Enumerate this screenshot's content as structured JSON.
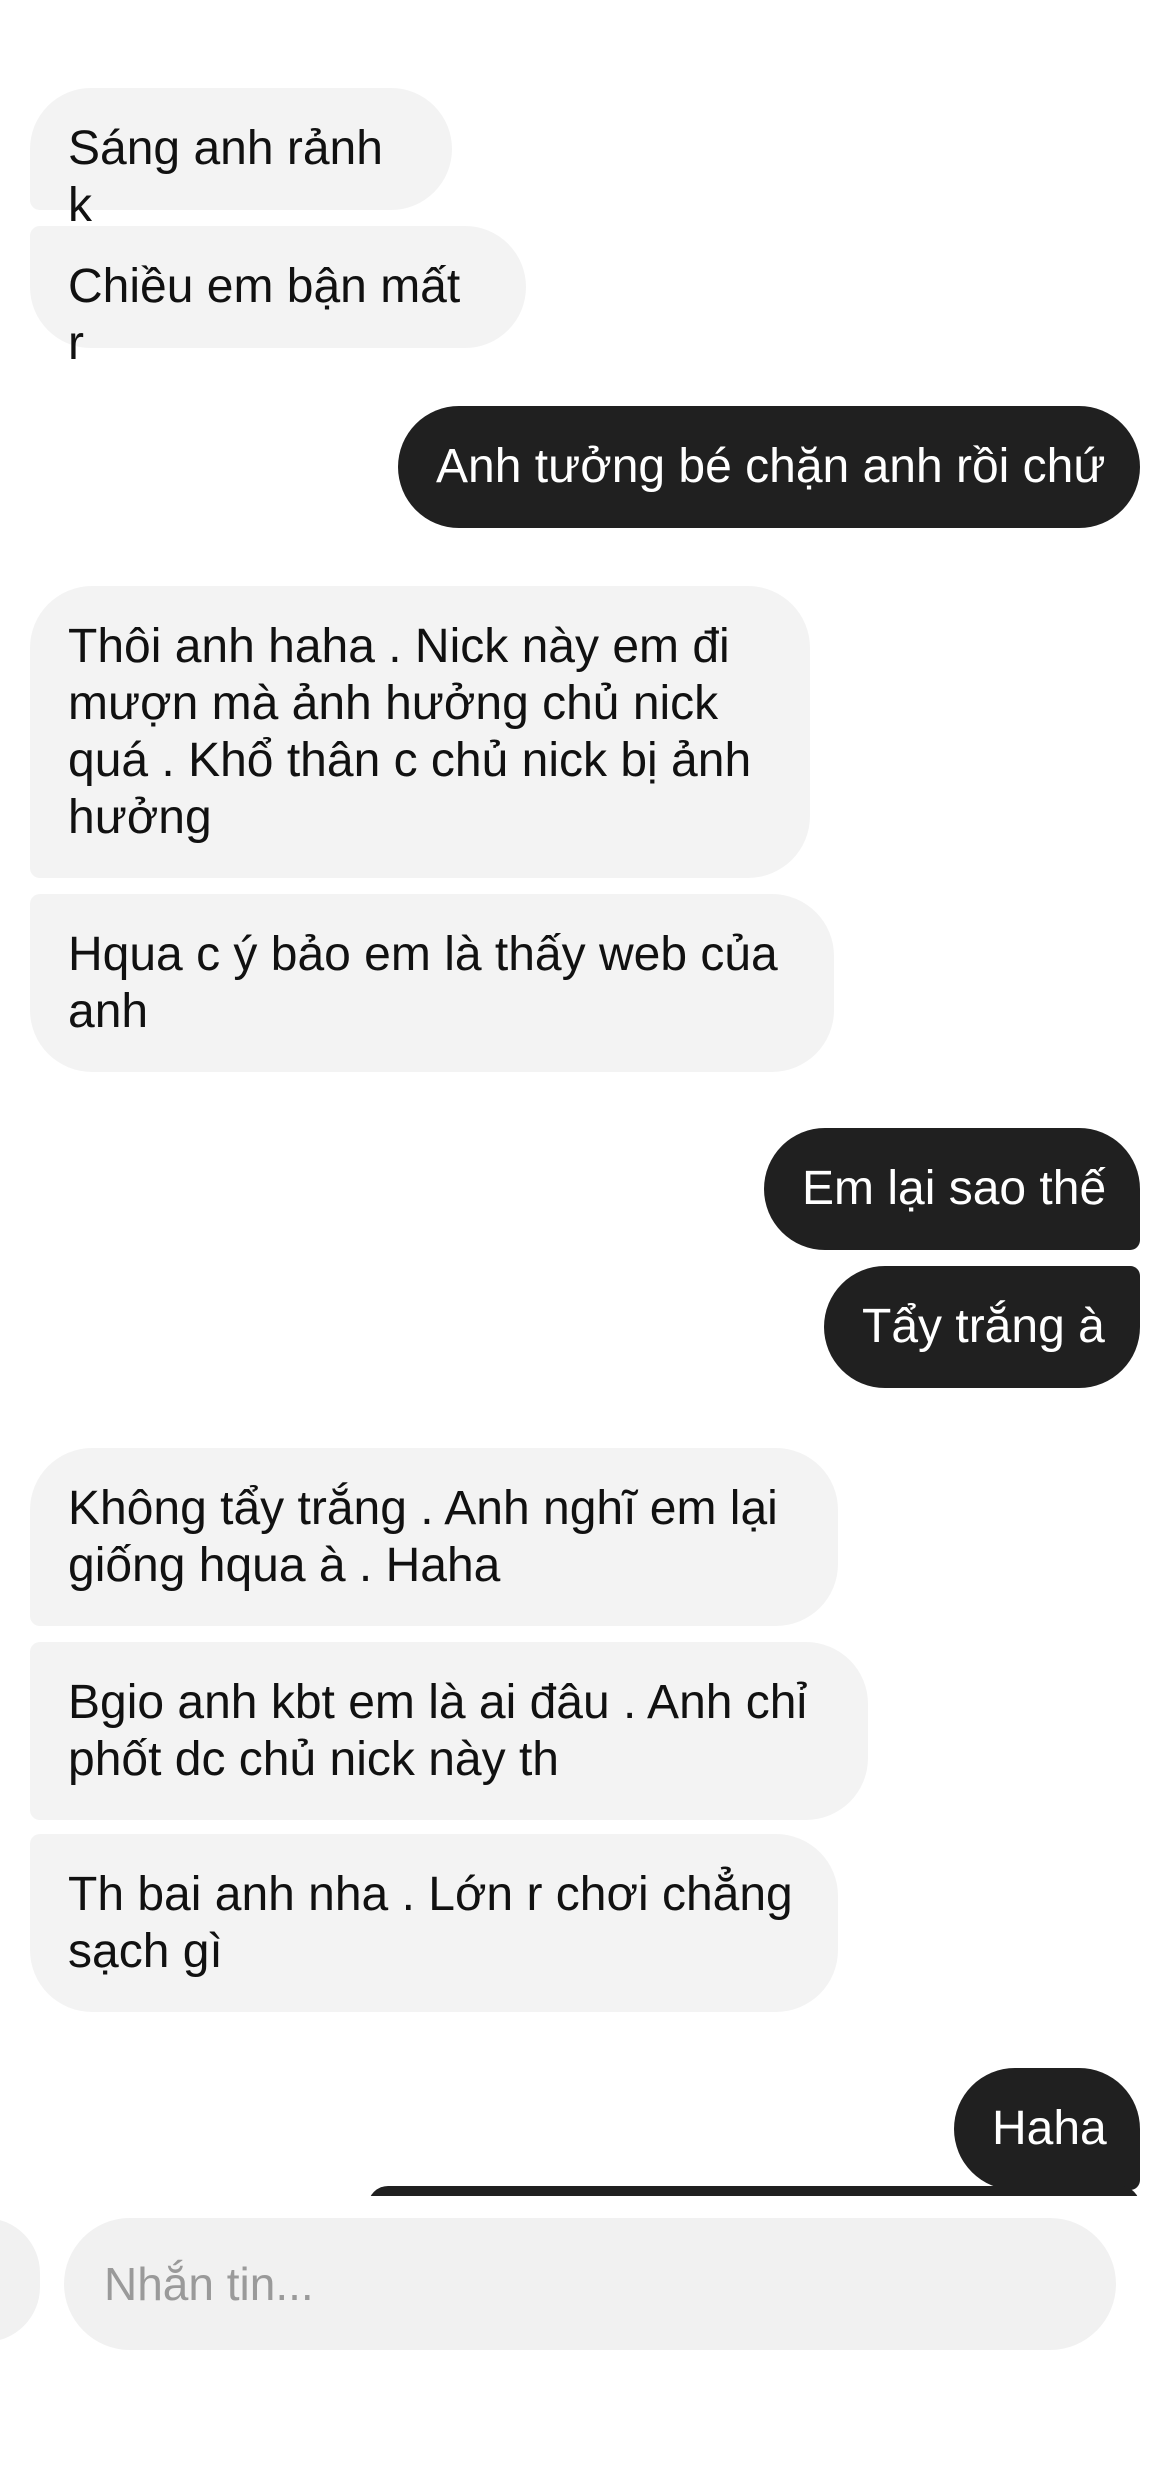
{
  "messages": [
    {
      "direction": "incoming",
      "text": "Sáng anh rảnh k"
    },
    {
      "direction": "incoming",
      "text": "Chiều em bận mất r"
    },
    {
      "direction": "outgoing",
      "text": "Anh tưởng bé chặn anh rồi chứ"
    },
    {
      "direction": "incoming",
      "text": "Thôi anh haha . Nick này em đi mượn mà ảnh hưởng chủ nick quá . Khổ thân c chủ nick bị ảnh hưởng"
    },
    {
      "direction": "incoming",
      "text": "Hqua c ý bảo em là thấy web của anh"
    },
    {
      "direction": "outgoing",
      "text": "Em lại sao thế"
    },
    {
      "direction": "outgoing",
      "text": "Tẩy trắng à"
    },
    {
      "direction": "incoming",
      "text": "Không tẩy trắng . Anh nghĩ em lại giống hqua à . Haha"
    },
    {
      "direction": "incoming",
      "text": "Bgio anh kbt em là ai đâu . Anh chỉ phốt dc chủ nick này th"
    },
    {
      "direction": "incoming",
      "text": "Th bai anh nha . Lớn r chơi chẳng sạch gì"
    },
    {
      "direction": "outgoing",
      "text": "Haha"
    }
  ],
  "composer": {
    "placeholder": "Nhắn tin..."
  },
  "colors": {
    "incoming_bubble": "#f3f3f3",
    "outgoing_bubble": "#202020",
    "incoming_text": "#111111",
    "outgoing_text": "#ffffff",
    "placeholder": "#9a9a9a"
  }
}
